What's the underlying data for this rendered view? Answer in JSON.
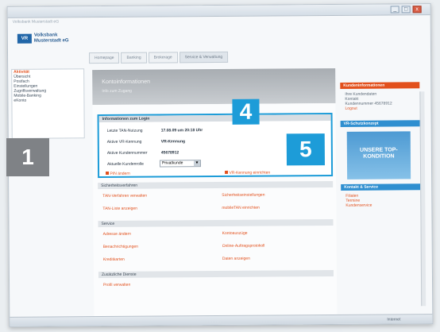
{
  "window": {
    "controls": [
      "_",
      "□",
      "x"
    ],
    "address": "Volksbank Musterstadt eG"
  },
  "header": {
    "logo_mark": "VR",
    "logo_text_1": "Volksbank",
    "logo_text_2": "Musterstadt eG"
  },
  "nav": {
    "tabs": [
      "Homepage",
      "Banking",
      "Brokerage",
      "Service & Verwaltung"
    ]
  },
  "sidebar": {
    "items": [
      "Aktivität",
      "Übersicht",
      "Postfach",
      "Einstellungen",
      "Zugriffsverwaltung",
      "Mobile-Banking",
      "eKonto"
    ]
  },
  "callouts": {
    "one": "1",
    "four": "4",
    "five": "5"
  },
  "banner": {
    "title": "Kontoinformationen",
    "subtitle": "Info zum Zugang"
  },
  "info_panel": {
    "heading": "Informationen zum Login",
    "rows": [
      {
        "label": "Letzte TAN-Nutzung",
        "value": "17.08.09 um 20:18 Uhr"
      },
      {
        "label": "Aktive VR-Kennung",
        "value": "VR-Kennung"
      },
      {
        "label": "Aktive Kundennummer",
        "value": "45678912"
      },
      {
        "label": "Aktuelle Kundenrolle",
        "value": "Privatkunde"
      }
    ],
    "link_left": "PIN ändern",
    "link_right": "VR-Kennung einrichten"
  },
  "sections": [
    {
      "title": "Sicherheitsverfahren",
      "links": [
        "TAN-Verfahren verwalten",
        "Sicherheitseinstellungen",
        "TAN-Liste anzeigen",
        "mobileTAN einrichten"
      ]
    },
    {
      "title": "Service",
      "links": [
        "Adresse ändern",
        "Kontoauszüge",
        "Benachrichtigungen",
        "Online-Auftragsprotokoll",
        "Kreditkarten",
        "Daten anzeigen"
      ]
    },
    {
      "title": "Zusätzliche Dienste",
      "links": [
        "Profil verwalten"
      ]
    }
  ],
  "right_col": {
    "sections": [
      {
        "title": "Kundeninformationen",
        "lines": [
          "Ihre Kundendaten",
          "Kontakt",
          "Kundennummer 45678912",
          "Logout"
        ]
      },
      {
        "title": "VR-Schutzkonzept",
        "promo": "UNSERE TOP-KONDITION"
      },
      {
        "title": "Kontakt & Service",
        "lines": [
          "Filialen",
          "Termine",
          "Kundenservice"
        ]
      }
    ]
  },
  "status": {
    "zone": "Internet"
  }
}
